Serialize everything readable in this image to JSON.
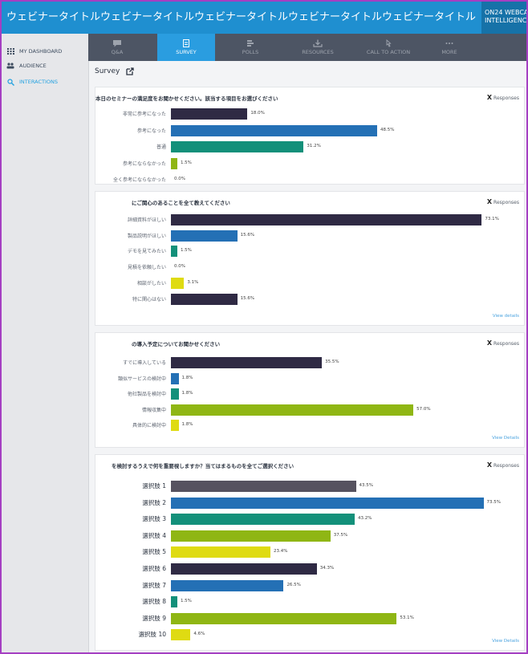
{
  "window_title": "ウェビナータイトルウェビナータイトルウェビナータイトルウェビナータイトルウェビナータイトル",
  "brand": {
    "line1": "ON24 WEBCAS",
    "line2": "INTELLIGENC"
  },
  "sidebar": {
    "items": [
      {
        "label": "MY DASHBOARD",
        "icon": "grid-icon"
      },
      {
        "label": "AUDIENCE",
        "icon": "people-icon"
      },
      {
        "label": "INTERACTIONS",
        "icon": "magnifier-icon"
      }
    ]
  },
  "tabs": [
    {
      "label": "Q&A",
      "icon": "chat-icon"
    },
    {
      "label": "SURVEY",
      "icon": "clipboard-icon"
    },
    {
      "label": "POLLS",
      "icon": "poll-icon"
    },
    {
      "label": "RESOURCES",
      "icon": "download-icon"
    },
    {
      "label": "CALL TO ACTION",
      "icon": "pointer-icon"
    },
    {
      "label": "MORE",
      "icon": "dots-icon"
    }
  ],
  "survey": {
    "heading": "Survey"
  },
  "colors": {
    "dark": "#2f2a44",
    "blue": "#2470b5",
    "teal": "#13907a",
    "green": "#8fb614",
    "yellow": "#dfdb12",
    "gray": "#56525f",
    "link": "#4aa3df"
  },
  "questions": [
    {
      "title": "本日のセミナーの満足度をお聞かせください。該当する項目をお選びください",
      "responses_label": "Responses",
      "view_details": "",
      "rows": [
        {
          "label": "非常に参考になった",
          "pct": "18.0%",
          "value": 18.0,
          "color": "dark"
        },
        {
          "label": "参考になった",
          "pct": "48.5%",
          "value": 48.5,
          "color": "blue"
        },
        {
          "label": "普通",
          "pct": "31.2%",
          "value": 31.2,
          "color": "teal"
        },
        {
          "label": "参考にならなかった",
          "pct": "1.5%",
          "value": 1.5,
          "color": "green"
        },
        {
          "label": "全く参考にならなかった",
          "pct": "0.0%",
          "value": 0.0,
          "color": "yellow"
        }
      ]
    },
    {
      "title": "にご関心のあることを全て教えてください",
      "responses_label": "Responses",
      "view_details": "View details",
      "rows": [
        {
          "label": "詳細資料がほしい",
          "pct": "73.1%",
          "value": 73.1,
          "color": "dark"
        },
        {
          "label": "製品説明がほしい",
          "pct": "15.6%",
          "value": 15.6,
          "color": "blue"
        },
        {
          "label": "デモを見てみたい",
          "pct": "1.5%",
          "value": 1.5,
          "color": "teal"
        },
        {
          "label": "見積を依頼したい",
          "pct": "0.0%",
          "value": 0.0,
          "color": "green"
        },
        {
          "label": "相談がしたい",
          "pct": "3.1%",
          "value": 3.1,
          "color": "yellow"
        },
        {
          "label": "特に関心はない",
          "pct": "15.6%",
          "value": 15.6,
          "color": "dark"
        }
      ]
    },
    {
      "title": "の導入予定についてお聞かせください",
      "responses_label": "Responses",
      "view_details": "View Details",
      "rows": [
        {
          "label": "すでに導入している",
          "pct": "35.5%",
          "value": 35.5,
          "color": "dark"
        },
        {
          "label": "類似サービスの検討中",
          "pct": "1.8%",
          "value": 1.8,
          "color": "blue"
        },
        {
          "label": "他社製品を検討中",
          "pct": "1.8%",
          "value": 1.8,
          "color": "teal"
        },
        {
          "label": "情報収集中",
          "pct": "57.0%",
          "value": 57.0,
          "color": "green"
        },
        {
          "label": "具体的に検討中",
          "pct": "1.8%",
          "value": 1.8,
          "color": "yellow"
        }
      ]
    },
    {
      "title": "を検討するうえで何を重要視しますか？当てはまるものを全てご選択ください",
      "responses_label": "Responses",
      "view_details": "View Details",
      "rows": [
        {
          "label": "選択肢 1",
          "pct": "43.5%",
          "value": 43.5,
          "color": "gray"
        },
        {
          "label": "選択肢 2",
          "pct": "73.5%",
          "value": 73.5,
          "color": "blue"
        },
        {
          "label": "選択肢 3",
          "pct": "43.2%",
          "value": 43.2,
          "color": "teal"
        },
        {
          "label": "選択肢 4",
          "pct": "37.5%",
          "value": 37.5,
          "color": "green"
        },
        {
          "label": "選択肢 5",
          "pct": "23.4%",
          "value": 23.4,
          "color": "yellow"
        },
        {
          "label": "選択肢 6",
          "pct": "34.3%",
          "value": 34.3,
          "color": "dark"
        },
        {
          "label": "選択肢 7",
          "pct": "26.5%",
          "value": 26.5,
          "color": "blue"
        },
        {
          "label": "選択肢 8",
          "pct": "1.5%",
          "value": 1.5,
          "color": "teal"
        },
        {
          "label": "選択肢 9",
          "pct": "53.1%",
          "value": 53.1,
          "color": "green"
        },
        {
          "label": "選択肢 10",
          "pct": "4.6%",
          "value": 4.6,
          "color": "yellow"
        }
      ]
    }
  ]
}
